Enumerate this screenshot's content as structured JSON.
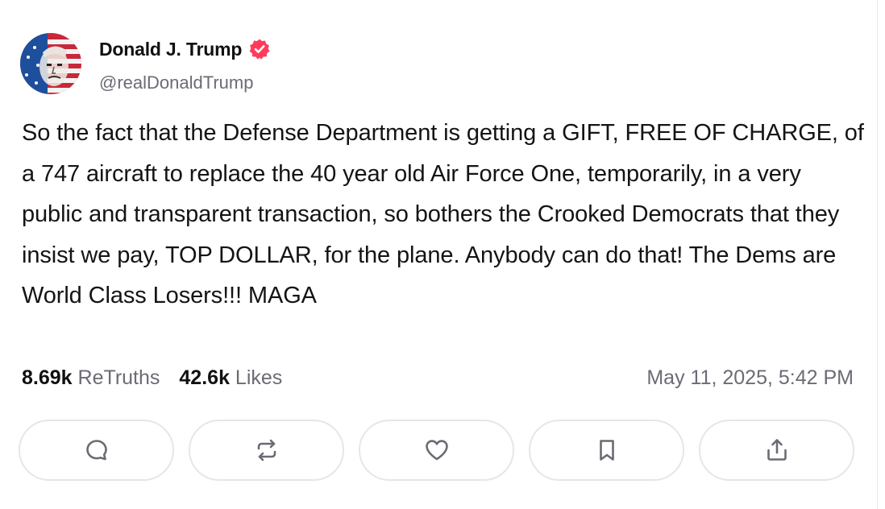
{
  "author": {
    "display_name": "Donald J. Trump",
    "handle": "@realDonaldTrump"
  },
  "post": {
    "text": "So the fact that the Defense Department is getting a GIFT, FREE OF CHARGE, of a 747 aircraft to replace the 40 year old Air Force One, temporarily, in a very public and transparent transaction, so bothers the Crooked Democrats that they insist we pay, TOP DOLLAR, for the plane. Anybody can do that! The Dems are World Class Losers!!! MAGA"
  },
  "stats": {
    "retruths_count": "8.69k",
    "retruths_label": "ReTruths",
    "likes_count": "42.6k",
    "likes_label": "Likes"
  },
  "timestamp": "May 11, 2025, 5:42 PM",
  "actions": [
    {
      "icon": "reply-icon"
    },
    {
      "icon": "retruth-icon"
    },
    {
      "icon": "like-heart-icon"
    },
    {
      "icon": "bookmark-icon"
    },
    {
      "icon": "share-icon"
    }
  ],
  "colors": {
    "verified_badge": "#ff3b5c",
    "muted_text": "#6b6b75",
    "icon_gray": "#6b6b75",
    "button_border": "#e6e6ea"
  }
}
